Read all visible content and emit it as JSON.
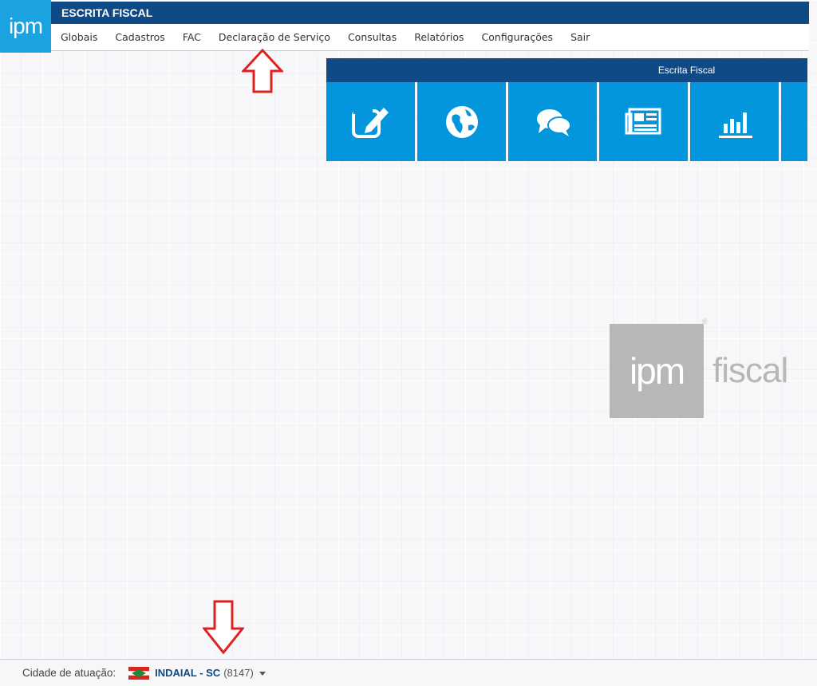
{
  "app": {
    "logo_text": "ipm",
    "title": "ESCRITA FISCAL"
  },
  "menu": {
    "items": [
      {
        "label": "Globais"
      },
      {
        "label": "Cadastros"
      },
      {
        "label": "FAC"
      },
      {
        "label": "Declaração de Serviço"
      },
      {
        "label": "Consultas"
      },
      {
        "label": "Relatórios"
      },
      {
        "label": "Configurações"
      },
      {
        "label": "Sair"
      }
    ]
  },
  "panel": {
    "title": "Escrita Fiscal",
    "tiles": [
      {
        "icon": "edit-icon"
      },
      {
        "icon": "globe-icon"
      },
      {
        "icon": "chat-icon"
      },
      {
        "icon": "newspaper-icon"
      },
      {
        "icon": "bar-chart-icon"
      }
    ]
  },
  "watermark": {
    "logo_text": "ipm",
    "brand_text": "fiscal",
    "registered": "®"
  },
  "footer": {
    "label": "Cidade de atuação:",
    "city": "INDAIAL - SC",
    "code": "(8147)"
  },
  "colors": {
    "primary_dark": "#0f4a86",
    "tile_blue": "#0496dc",
    "logo_blue": "#1aa3e0",
    "arrow_red": "#e02020"
  }
}
